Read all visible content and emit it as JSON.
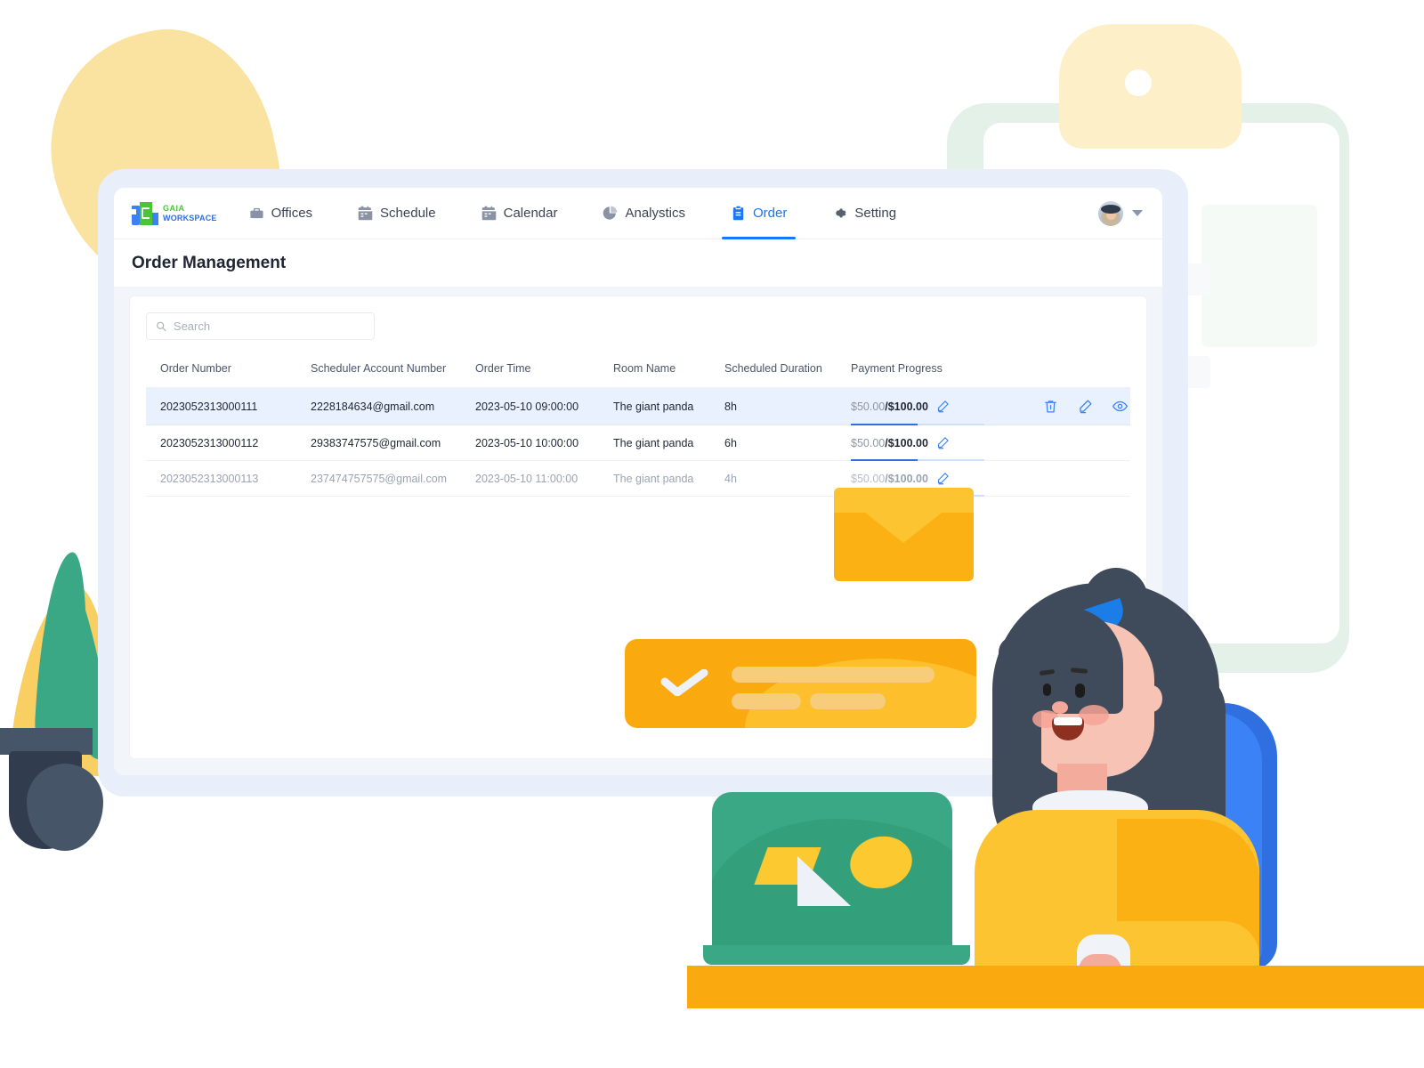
{
  "brand": {
    "name_line1": "GAIA",
    "name_line2": "WORKSPACE"
  },
  "nav": {
    "items": [
      {
        "label": "Offices",
        "icon": "briefcase-icon",
        "active": false
      },
      {
        "label": "Schedule",
        "icon": "calendar-icon",
        "active": false
      },
      {
        "label": "Calendar",
        "icon": "calendar-icon",
        "active": false
      },
      {
        "label": "Analystics",
        "icon": "pie-chart-icon",
        "active": false
      },
      {
        "label": "Order",
        "icon": "clipboard-icon",
        "active": true
      },
      {
        "label": "Setting",
        "icon": "gear-icon",
        "active": false
      }
    ],
    "account": {
      "avatar": "user-avatar",
      "caret": "chevron-down-icon"
    }
  },
  "header": {
    "title": "Order Management"
  },
  "search": {
    "value": "",
    "placeholder": "Search",
    "icon": "search-icon"
  },
  "table": {
    "columns": [
      "Order Number",
      "Scheduler Account Number",
      "Order Time",
      "Room Name",
      "Scheduled Duration",
      "Payment Progress"
    ],
    "rows": [
      {
        "order_number": "2023052313000111",
        "account": "2228184634@gmail.com",
        "order_time": "2023-05-10 09:00:00",
        "room_name": "The giant panda",
        "duration": "8h",
        "paid": "$50.00",
        "separator": "/",
        "total": "$100.00",
        "progress_percent": 50,
        "highlighted": true,
        "dim": false,
        "actions": [
          "delete-icon",
          "edit-icon",
          "view-icon"
        ]
      },
      {
        "order_number": "2023052313000112",
        "account": "29383747575@gmail.com",
        "order_time": "2023-05-10 10:00:00",
        "room_name": "The giant panda",
        "duration": "6h",
        "paid": "$50.00",
        "separator": "/",
        "total": "$100.00",
        "progress_percent": 50,
        "highlighted": false,
        "dim": false,
        "actions": []
      },
      {
        "order_number": "2023052313000113",
        "account": "237474757575@gmail.com",
        "order_time": "2023-05-10 11:00:00",
        "room_name": "The giant panda",
        "duration": "4h",
        "paid": "$50.00",
        "separator": "/",
        "total": "$100.00",
        "progress_percent": 50,
        "highlighted": false,
        "dim": true,
        "actions": []
      }
    ]
  },
  "colors": {
    "accent_blue": "#1677ff",
    "progress_fill": "#2f6fe0",
    "progress_track": "#cfe0fb",
    "row_highlight": "#e9f1fe",
    "brand_green": "#4cc437",
    "brand_blue": "#2f6fe0",
    "illustration_yellow": "#fbb014",
    "illustration_green": "#3aa884",
    "window_chrome": "#e8effa"
  }
}
